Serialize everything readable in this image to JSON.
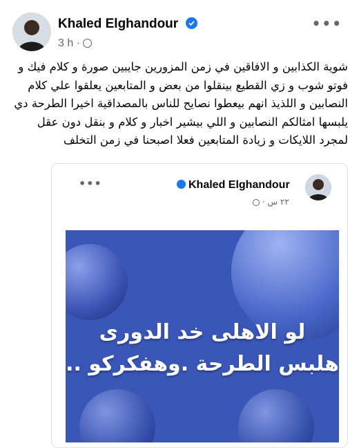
{
  "post": {
    "author_name": "Khaled Elghandour",
    "time_ago": "3 h",
    "separator": "·",
    "text": "شوية الكذابين و الافاقين في زمن المزورين جايبين صورة و كلام فيك و فوتو شوب و زي القطيع بينقلوا من بعض و المتابعين يعلقوا علي كلام  النصابين و اللذيذ انهم بيعطوا نصايح للناس بالمصداقية  اخيرا الطرحة دي يلبسها امثالكم النصابين و اللي بيشير اخبار و كلام و بنقل دون عقل لمجرد اللايكات و زيادة المتابعين  فعلا اصبحنا في زمن  التخلف"
  },
  "shared": {
    "author_name": "Khaled Elghandour",
    "time_ago": "٢٢ س ·",
    "image_text": "لو الاهلى خد الدورى هلبس الطرحة .وهفكركو .."
  },
  "icons": {
    "verified": "verified-badge-icon",
    "globe": "globe-icon",
    "more": "more-options-icon"
  },
  "colors": {
    "verified": "#1877f2",
    "banner": "#3a57b8",
    "meta": "#65676b"
  }
}
